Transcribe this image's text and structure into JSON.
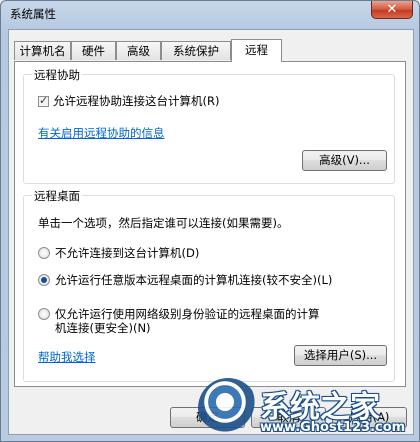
{
  "window": {
    "title": "系统属性",
    "close_glyph": "✕"
  },
  "tabs": [
    {
      "label": "计算机名"
    },
    {
      "label": "硬件"
    },
    {
      "label": "高级"
    },
    {
      "label": "系统保护"
    },
    {
      "label": "远程"
    }
  ],
  "active_tab": "远程",
  "remote_assistance": {
    "title": "远程协助",
    "allow_checkbox_label": "允许远程协助连接这台计算机(R)",
    "allow_checked": true,
    "info_link": "有关启用远程协助的信息",
    "advanced_button": "高级(V)..."
  },
  "remote_desktop": {
    "title": "远程桌面",
    "instruction": "单击一个选项，然后指定谁可以连接(如果需要)。",
    "options": [
      {
        "label": "不允许连接到这台计算机(D)",
        "selected": false
      },
      {
        "label": "允许运行任意版本远程桌面的计算机连接(较不安全)(L)",
        "selected": true
      },
      {
        "label_line1": "仅允许运行使用网络级别身份验证的远程桌面的计算",
        "label_line2": "机连接(更安全)(N)",
        "selected": false
      }
    ],
    "help_link": "帮助我选择",
    "select_users_button": "选择用户(S)..."
  },
  "footer": {
    "ok_button": "确定",
    "cancel_button": "取消",
    "apply_button": "应用(A)"
  },
  "watermark": {
    "text": "系统之家",
    "url": "www.Ghost123.com"
  }
}
